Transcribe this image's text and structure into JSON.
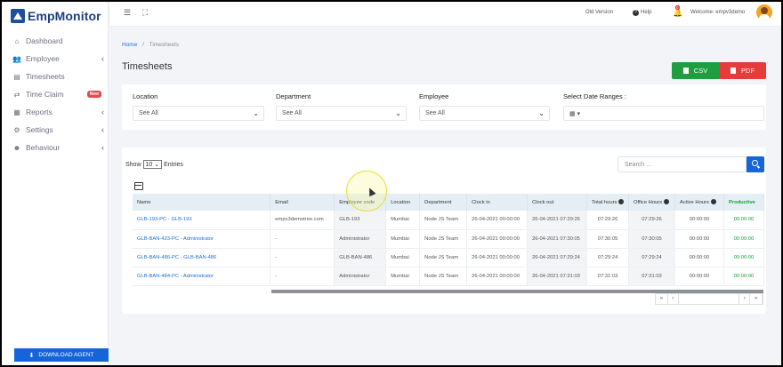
{
  "brand": {
    "name": "EmpMonitor"
  },
  "sidebar": {
    "items": [
      {
        "label": "Dashboard",
        "icon": "home-icon",
        "glyph": "⌂",
        "chevron": false
      },
      {
        "label": "Employee",
        "icon": "users-icon",
        "glyph": "👥",
        "chevron": true
      },
      {
        "label": "Timesheets",
        "icon": "document-icon",
        "glyph": "▤",
        "chevron": false
      },
      {
        "label": "Time Claim",
        "icon": "exchange-icon",
        "glyph": "⇄",
        "chevron": false,
        "badge": "New"
      },
      {
        "label": "Reports",
        "icon": "report-icon",
        "glyph": "▦",
        "chevron": true
      },
      {
        "label": "Settings",
        "icon": "gear-icon",
        "glyph": "⚙",
        "chevron": true
      },
      {
        "label": "Behaviour",
        "icon": "behaviour-icon",
        "glyph": "☻",
        "chevron": true
      }
    ],
    "download_label": "DOWNLOAD AGENT"
  },
  "header": {
    "old_version": "Old Version",
    "help": "Help",
    "notification_count": "0",
    "welcome": "Welcome: empv3demo"
  },
  "breadcrumb": {
    "home": "Home",
    "separator": "/",
    "current": "Timesheets"
  },
  "page_title": "Timesheets",
  "export": {
    "csv": "CSV",
    "pdf": "PDF"
  },
  "filters": {
    "location": {
      "label": "Location",
      "value": "See All"
    },
    "department": {
      "label": "Department",
      "value": "See All"
    },
    "employee": {
      "label": "Employee",
      "value": "See All"
    },
    "date_range": {
      "label": "Select Date Ranges :"
    }
  },
  "table": {
    "show_label": "Show",
    "entries_value": "10",
    "entries_label": "Entries",
    "search_placeholder": "Search ...",
    "columns": [
      "Name",
      "Email",
      "Employee code",
      "Location",
      "Department",
      "Clock in",
      "Clock out",
      "Total hours",
      "Office Hours",
      "Active Hours",
      "Productive"
    ],
    "rows": [
      [
        "GLB-193-PC - GLB-193",
        "empv3demotree.com",
        "GLB-193",
        "Mumbai",
        "Node JS Team",
        "26-04-2021 00:00:00",
        "26-04-2021 07:29:26",
        "07:29:26",
        "07:29:26",
        "00:00:00",
        "00:00:00"
      ],
      [
        "GLB-BAN-423-PC - Administrator",
        "-",
        "Administrator",
        "Mumbai",
        "Node JS Team",
        "26-04-2021 00:00:00",
        "26-04-2021 07:30:05",
        "07:30:05",
        "07:30:05",
        "00:00:00",
        "00:00:00"
      ],
      [
        "GLB-BAN-486-PC - GLB-BAN-486",
        "-",
        "GLB-BAN-486",
        "Mumbai",
        "Node JS Team",
        "26-04-2021 00:00:00",
        "26-04-2021 07:29:24",
        "07:29:24",
        "07:29:24",
        "00:00:00",
        "00:00:00"
      ],
      [
        "GLB-BAN-484-PC - Administrator",
        "-",
        "Administrator",
        "Mumbai",
        "Node JS Team",
        "26-04-2021 00:00:00",
        "26-04-2021 07:31:03",
        "07:31:03",
        "07:31:03",
        "00:00:00",
        "00:00:00"
      ]
    ],
    "pager": [
      "«",
      "‹",
      "",
      "›",
      "»"
    ]
  },
  "colors": {
    "accent": "#1565d8",
    "csv": "#1e9e3e",
    "pdf": "#e53b3b",
    "productive": "#1a9e3d"
  }
}
